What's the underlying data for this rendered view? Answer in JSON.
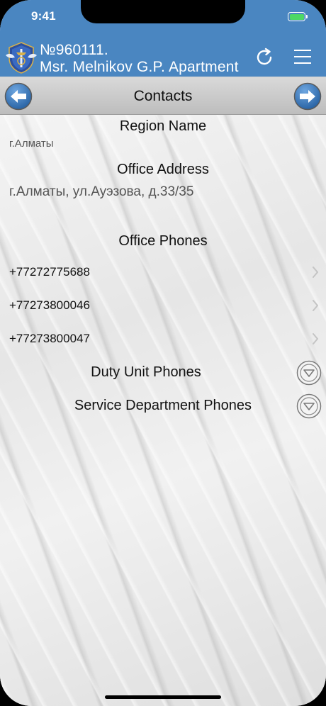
{
  "status_bar": {
    "time": "9:41"
  },
  "header": {
    "title_line1": "№960111.",
    "title_line2": "Msr. Melnikov G.P. Apartment"
  },
  "navbar": {
    "title": "Contacts"
  },
  "region": {
    "heading": "Region Name",
    "value": "г.Алматы"
  },
  "office_address": {
    "heading": "Office Address",
    "value": "г.Алматы, ул.Ауэзова, д.33/35"
  },
  "office_phones": {
    "heading": "Office Phones",
    "items": [
      "+77272775688",
      "+77273800046",
      "+77273800047"
    ]
  },
  "duty_unit": {
    "label": "Duty Unit Phones"
  },
  "service_department": {
    "label": "Service Department Phones"
  },
  "colors": {
    "header_bg": "#4a86c1",
    "nav_button": "#2f6fb3",
    "battery": "#4cd964"
  },
  "icons": {
    "logo": "emblem-logo-icon",
    "refresh": "refresh-icon",
    "menu": "hamburger-menu-icon",
    "back": "arrow-left-icon",
    "forward": "arrow-right-icon",
    "chevron": "chevron-right-icon",
    "expand": "chevron-down-circle-icon"
  }
}
